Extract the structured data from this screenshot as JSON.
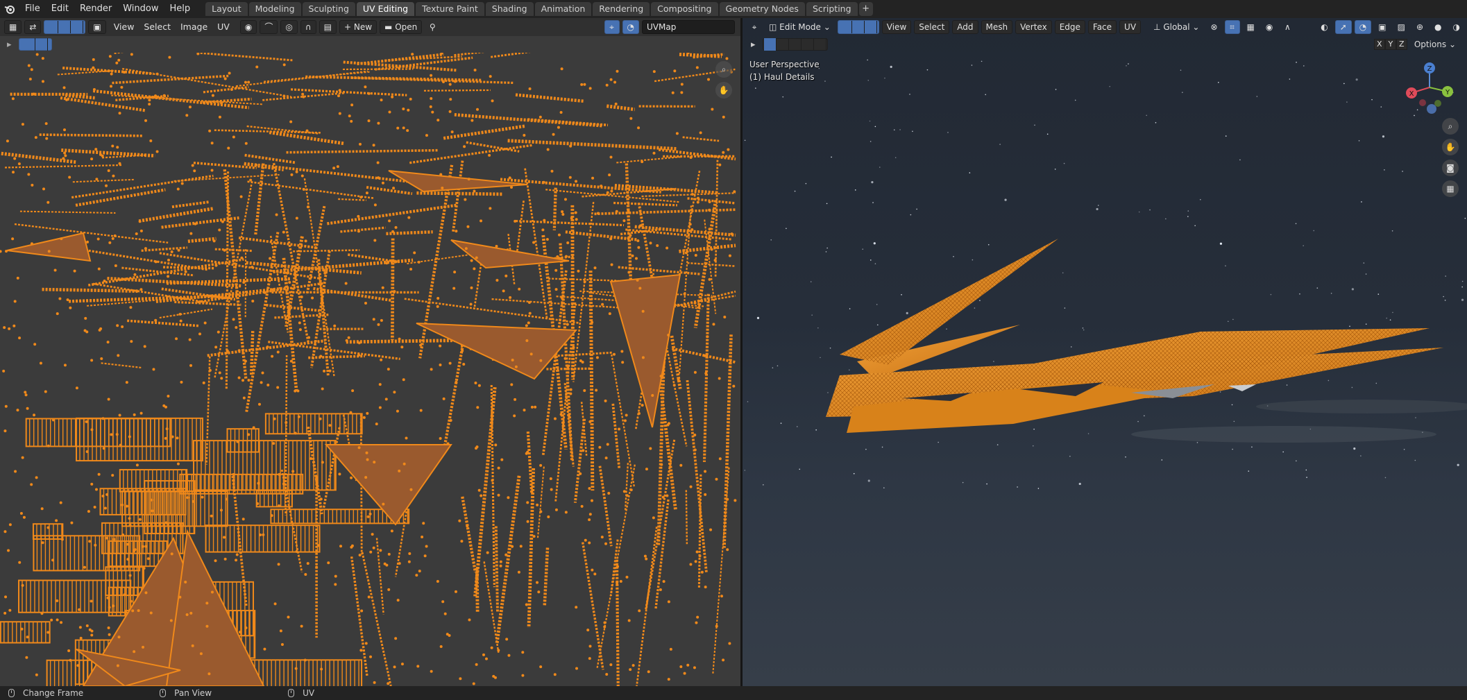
{
  "topbar": {
    "menus": [
      "File",
      "Edit",
      "Render",
      "Window",
      "Help"
    ],
    "workspace_tabs": [
      "Layout",
      "Modeling",
      "Sculpting",
      "UV Editing",
      "Texture Paint",
      "Shading",
      "Animation",
      "Rendering",
      "Compositing",
      "Geometry Nodes",
      "Scripting"
    ],
    "active_tab": "UV Editing",
    "add_tab_label": "+"
  },
  "uv_editor": {
    "menus": [
      "View",
      "Select",
      "Image",
      "UV"
    ],
    "new_label": "New",
    "open_label": "Open",
    "uvmap_value": "UVMap"
  },
  "viewport": {
    "mode_label": "Edit Mode",
    "menus": [
      "View",
      "Select",
      "Add",
      "Mesh",
      "Vertex",
      "Edge",
      "Face",
      "UV"
    ],
    "orientation_label": "Global",
    "options_label": "Options",
    "axis_x": "X",
    "axis_y": "Y",
    "axis_z": "Z",
    "perspective_label": "User Perspective",
    "object_label": "(1) Haul Details",
    "gizmo": {
      "x": "X",
      "y": "Y",
      "z": "Z"
    }
  },
  "statusbar": {
    "items": [
      "Change Frame",
      "Pan View",
      "UV"
    ]
  },
  "colors": {
    "accent": "#4772b3",
    "uv_wire": "#f0891a",
    "uv_fill": "#9a5a2e",
    "mesh": "#e8901e"
  }
}
